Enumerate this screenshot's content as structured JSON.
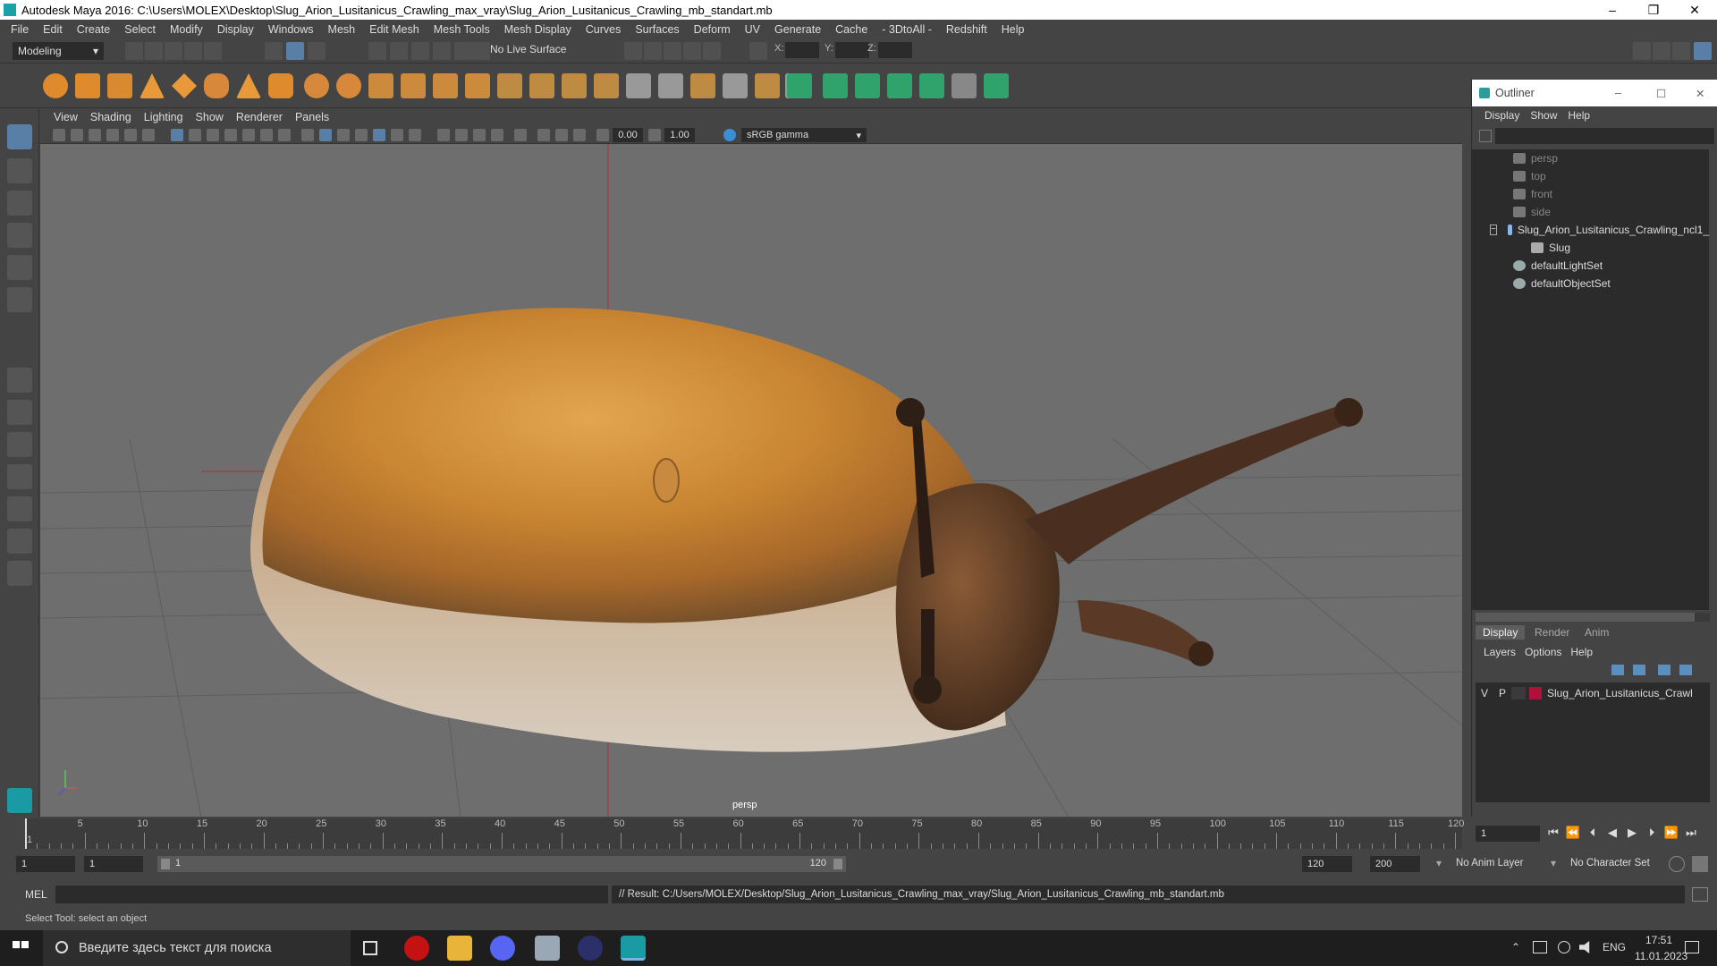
{
  "window": {
    "title": "Autodesk Maya 2016: C:\\Users\\MOLEX\\Desktop\\Slug_Arion_Lusitanicus_Crawling_max_vray\\Slug_Arion_Lusitanicus_Crawling_mb_standart.mb",
    "minimize": "–",
    "maximize": "❐",
    "close": "✕"
  },
  "menubar": [
    "File",
    "Edit",
    "Create",
    "Select",
    "Modify",
    "Display",
    "Windows",
    "Mesh",
    "Edit Mesh",
    "Mesh Tools",
    "Mesh Display",
    "Curves",
    "Surfaces",
    "Deform",
    "UV",
    "Generate",
    "Cache",
    "- 3DtoAll -",
    "Redshift",
    "Help"
  ],
  "statusline": {
    "mode": "Modeling",
    "live_surface": "No Live Surface",
    "x_label": "X:",
    "y_label": "Y:",
    "z_label": "Z:"
  },
  "viewport": {
    "menu": [
      "View",
      "Shading",
      "Lighting",
      "Show",
      "Renderer",
      "Panels"
    ],
    "near_clip": "0.00",
    "exposure": "1.00",
    "color_space": "sRGB gamma",
    "camera_label": "persp"
  },
  "outliner": {
    "title": "Outliner",
    "menu": [
      "Display",
      "Show",
      "Help"
    ],
    "items": [
      {
        "label": "persp",
        "dim": true
      },
      {
        "label": "top",
        "dim": true
      },
      {
        "label": "front",
        "dim": true
      },
      {
        "label": "side",
        "dim": true
      },
      {
        "label": "Slug_Arion_Lusitanicus_Crawling_ncl1_",
        "dim": false
      },
      {
        "label": "Slug",
        "dim": false
      },
      {
        "label": "defaultLightSet",
        "dim": false
      },
      {
        "label": "defaultObjectSet",
        "dim": false
      }
    ]
  },
  "layer_editor": {
    "tabs": [
      "Display",
      "Render",
      "Anim"
    ],
    "menu": [
      "Layers",
      "Options",
      "Help"
    ],
    "layer": {
      "v": "V",
      "p": "P",
      "name": "Slug_Arion_Lusitanicus_Crawl",
      "color": "#b0103a"
    }
  },
  "timeline": {
    "ticks": [
      "5",
      "10",
      "15",
      "20",
      "25",
      "30",
      "35",
      "40",
      "45",
      "50",
      "55",
      "60",
      "65",
      "70",
      "75",
      "80",
      "85",
      "90",
      "95",
      "100",
      "105",
      "110",
      "115",
      "120"
    ],
    "start_marker": "1",
    "current_frame": "1"
  },
  "range": {
    "start": "1",
    "playback_start": "1",
    "slider_left": "1",
    "slider_right": "120",
    "playback_end": "120",
    "end": "200",
    "anim_layer": "No Anim Layer",
    "character_set": "No Character Set"
  },
  "command": {
    "language": "MEL",
    "result": "// Result: C:/Users/MOLEX/Desktop/Slug_Arion_Lusitanicus_Crawling_max_vray/Slug_Arion_Lusitanicus_Crawling_mb_standart.mb"
  },
  "help_line": "Select Tool: select an object",
  "taskbar": {
    "search_placeholder": "Введите здесь текст для поиска",
    "lang": "ENG",
    "time": "17:51",
    "date": "11.01.2023"
  }
}
